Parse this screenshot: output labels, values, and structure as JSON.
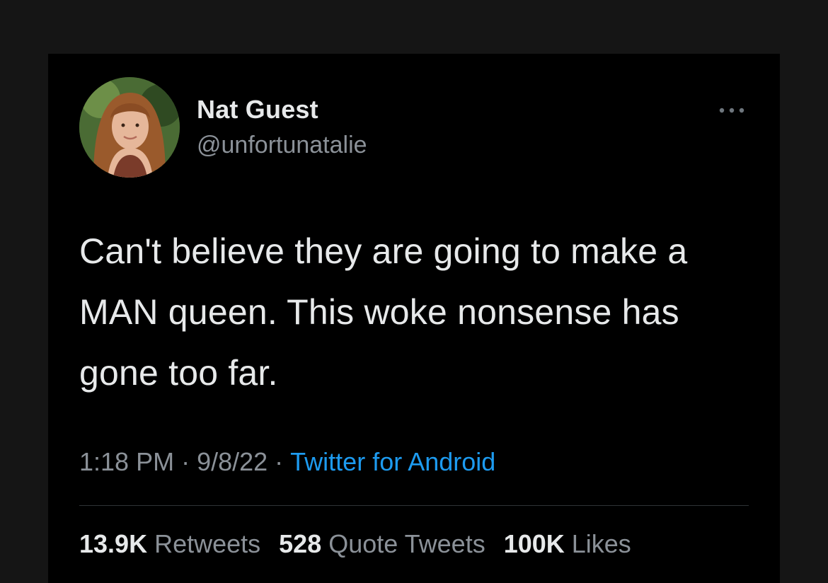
{
  "tweet": {
    "author": {
      "display_name": "Nat Guest",
      "handle": "@unfortunatalie"
    },
    "more_icon": "ellipsis-icon",
    "text": "Can't believe they are going to make a MAN queen. This woke nonsense has gone too far.",
    "time": "1:18 PM",
    "date": "9/8/22",
    "separator": "·",
    "source": "Twitter for Android",
    "stats": {
      "retweets": {
        "count": "13.9K",
        "label": "Retweets"
      },
      "quote_tweets": {
        "count": "528",
        "label": "Quote Tweets"
      },
      "likes": {
        "count": "100K",
        "label": "Likes"
      }
    }
  },
  "colors": {
    "background": "#000000",
    "frame": "#151515",
    "text_primary": "#e7e9ea",
    "text_secondary": "#8b9198",
    "link": "#1d9bf0",
    "divider": "#2f3336"
  }
}
